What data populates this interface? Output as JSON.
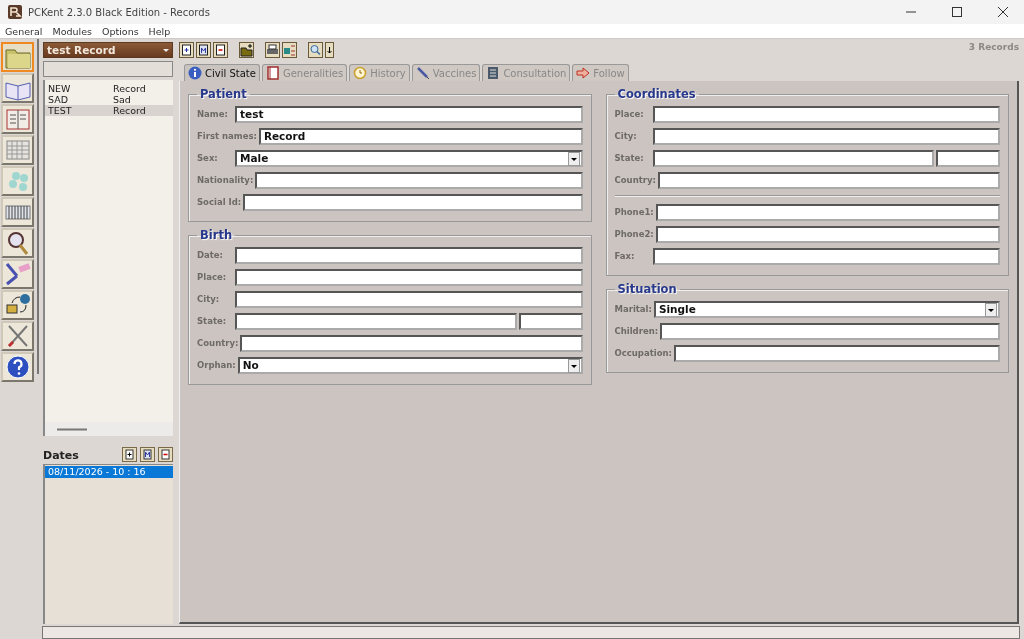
{
  "window": {
    "title": "PCKent 2.3.0 Black Edition - Records"
  },
  "menu": [
    "General",
    "Modules",
    "Options",
    "Help"
  ],
  "modules": [
    {
      "selected": true
    },
    {
      "selected": false
    },
    {
      "selected": false
    },
    {
      "selected": false
    },
    {
      "selected": false
    },
    {
      "selected": false
    },
    {
      "selected": false
    },
    {
      "selected": false
    },
    {
      "selected": false
    },
    {
      "selected": false
    },
    {
      "selected": false
    }
  ],
  "record_selector": {
    "value": "test Record"
  },
  "records": [
    {
      "code": "NEW",
      "name": "Record",
      "selected": false
    },
    {
      "code": "SAD",
      "name": "Sad",
      "selected": false
    },
    {
      "code": "TEST",
      "name": "Record",
      "selected": true
    }
  ],
  "dates": {
    "title": "Dates",
    "items": [
      {
        "text": "08/11/2026  -  10 : 16",
        "selected": true
      }
    ]
  },
  "record_count": "3 Records",
  "tabs": [
    {
      "label": "Civil State",
      "selected": true
    },
    {
      "label": "Generalities",
      "selected": false
    },
    {
      "label": "History",
      "selected": false
    },
    {
      "label": "Vaccines",
      "selected": false
    },
    {
      "label": "Consultation",
      "selected": false
    },
    {
      "label": "Follow",
      "selected": false
    }
  ],
  "columns": [
    [
      {
        "title": "Patient",
        "groups": [
          [
            {
              "label": "Name:",
              "kind": "text",
              "value": "test"
            },
            {
              "label": "First names:",
              "kind": "text",
              "value": "Record"
            },
            {
              "label": "Sex:",
              "kind": "select",
              "value": "Male"
            },
            {
              "label": "Nationality:",
              "kind": "text"
            },
            {
              "label": "Social Id:",
              "kind": "text"
            }
          ]
        ]
      },
      {
        "title": "Birth",
        "groups": [
          [
            {
              "label": "Date:",
              "kind": "text"
            },
            {
              "label": "Place:",
              "kind": "text"
            },
            {
              "label": "City:",
              "kind": "text"
            },
            {
              "label": "State:",
              "kind": "split"
            },
            {
              "label": "Country:",
              "kind": "text"
            },
            {
              "label": "Orphan:",
              "kind": "select",
              "value": "No"
            }
          ]
        ]
      }
    ],
    [
      {
        "title": "Coordinates",
        "groups": [
          [
            {
              "label": "Place:",
              "kind": "text"
            },
            {
              "label": "City:",
              "kind": "text"
            },
            {
              "label": "State:",
              "kind": "split"
            },
            {
              "label": "Country:",
              "kind": "text"
            }
          ],
          [
            {
              "label": "Phone1:",
              "kind": "text"
            },
            {
              "label": "Phone2:",
              "kind": "text"
            },
            {
              "label": "Fax:",
              "kind": "text"
            }
          ]
        ]
      },
      {
        "title": "Situation",
        "groups": [
          [
            {
              "label": "Marital:",
              "kind": "select",
              "value": "Single"
            },
            {
              "label": "Children:",
              "kind": "text"
            },
            {
              "label": "Occupation:",
              "kind": "text"
            }
          ]
        ]
      }
    ]
  ]
}
